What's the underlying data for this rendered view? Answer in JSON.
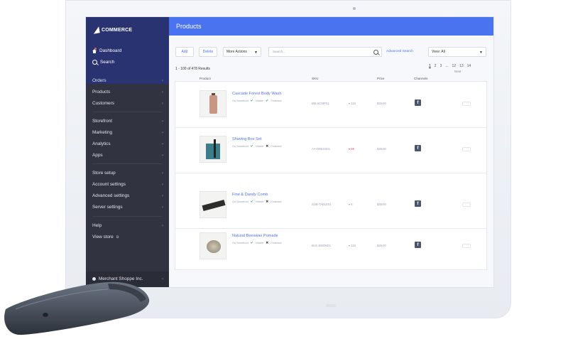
{
  "brand": {
    "logo_text": "COMMERCE"
  },
  "sidebar": {
    "top_items": [
      {
        "label": "Dashboard",
        "icon": "home-icon"
      },
      {
        "label": "Search",
        "icon": "search-icon"
      }
    ],
    "groups": [
      [
        "Orders",
        "Products",
        "Customers"
      ],
      [
        "Storefront",
        "Marketing",
        "Analytics",
        "Apps"
      ],
      [
        "Store setup",
        "Account settings",
        "Advanced settings",
        "Server settings"
      ],
      [
        "Help",
        "View store"
      ]
    ],
    "store_name": "Merchant Shoppe Inc."
  },
  "header": {
    "title": "Products"
  },
  "toolbar": {
    "add_label": "Add",
    "delete_label": "Delete",
    "more_actions_label": "More Actions",
    "search_placeholder": "Search...",
    "advanced_search_label": "Advanced Search",
    "view_select_value": "View: All"
  },
  "results_text": "1 - 100 of 478 Results",
  "pager": {
    "pages": [
      "1",
      "2",
      "3",
      "...",
      "12",
      "13",
      "14"
    ],
    "next_label": "Next"
  },
  "columns": [
    "Product",
    "SKU",
    "Price",
    "Channels"
  ],
  "products": [
    {
      "name": "Cascade Forest Body Wash",
      "tags": [
        "On Storefront",
        "Visible",
        "Featured"
      ],
      "sku": "BM-SCMP01",
      "stock": "116",
      "price": "$32.00",
      "channel": "f"
    },
    {
      "name": "Shaving Box Set",
      "tags": [
        "On Storefront",
        "Visible",
        "Featured"
      ],
      "sku": "AA-DRESS01",
      "stock": "08",
      "price": "$45.00",
      "channel": "f"
    },
    {
      "name": "Fine & Dandy Comb",
      "tags": [
        "On Storefront",
        "Visible",
        "Featured"
      ],
      "sku": "SUB-TABLE01",
      "stock": "6",
      "price": "$35.00",
      "channel": "f"
    },
    {
      "name": "Natural Beeswax Pomade",
      "tags": [
        "On Storefront",
        "Visible",
        "Featured"
      ],
      "sku": "BUL-SMOKE1",
      "stock": "116",
      "price": "$26.00",
      "channel": "f"
    }
  ],
  "colors": {
    "accent": "#4a73f0",
    "sidebar": "#313440",
    "sidebar_top": "#2a3372"
  }
}
